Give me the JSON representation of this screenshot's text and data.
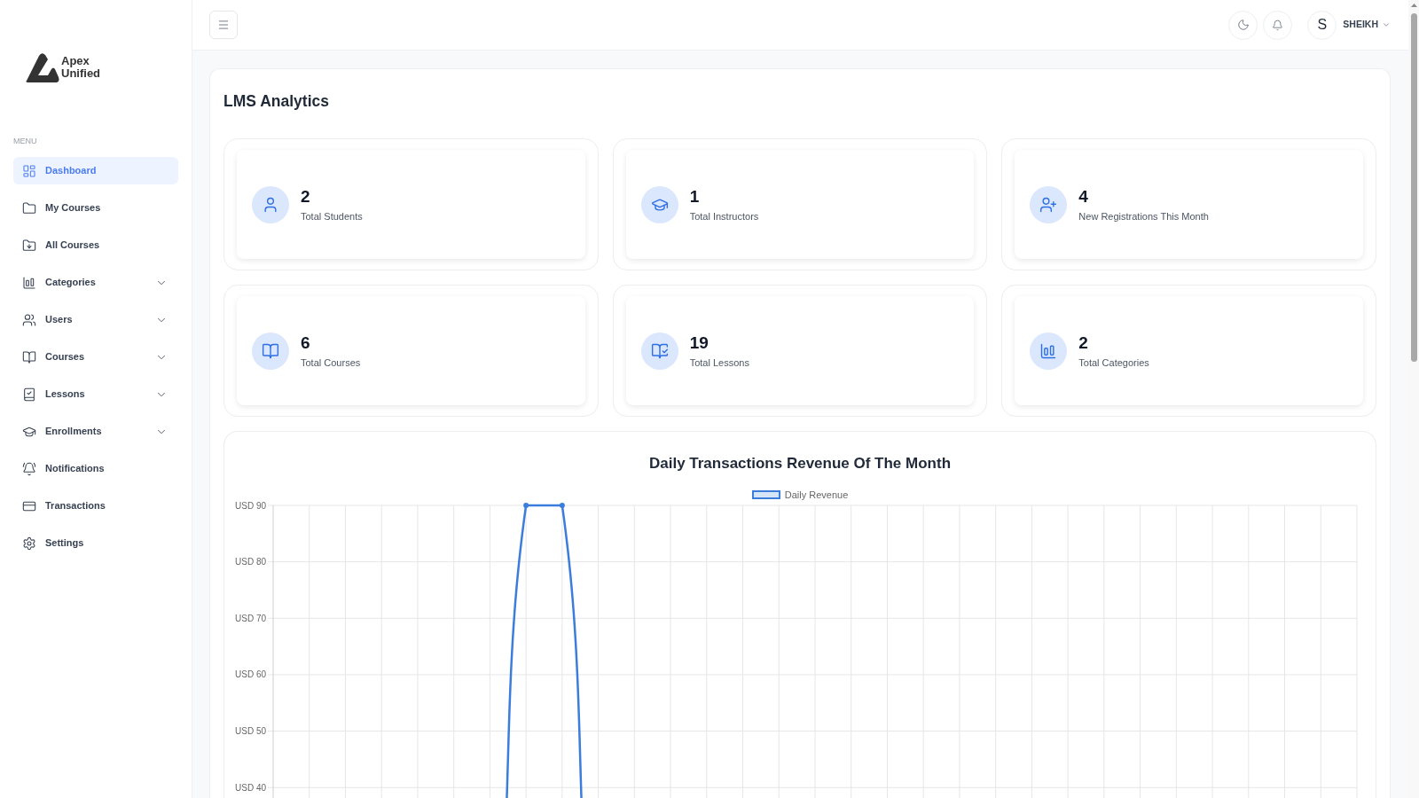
{
  "sidebar": {
    "brand": "Apex Unified",
    "section_label": "MENU",
    "items": [
      {
        "label": "Dashboard",
        "selected": true,
        "has_submenu": false
      },
      {
        "label": "My Courses",
        "selected": false,
        "has_submenu": false
      },
      {
        "label": "All Courses",
        "selected": false,
        "has_submenu": false
      },
      {
        "label": "Categories",
        "selected": false,
        "has_submenu": true
      },
      {
        "label": "Users",
        "selected": false,
        "has_submenu": true
      },
      {
        "label": "Courses",
        "selected": false,
        "has_submenu": true
      },
      {
        "label": "Lessons",
        "selected": false,
        "has_submenu": true
      },
      {
        "label": "Enrollments",
        "selected": false,
        "has_submenu": true
      },
      {
        "label": "Notifications",
        "selected": false,
        "has_submenu": false
      },
      {
        "label": "Transactions",
        "selected": false,
        "has_submenu": false
      },
      {
        "label": "Settings",
        "selected": false,
        "has_submenu": false
      }
    ]
  },
  "topbar": {
    "user": {
      "initial": "S",
      "name": "SHEIKH"
    }
  },
  "page": {
    "title": "LMS Analytics"
  },
  "stats": [
    {
      "value": "2",
      "label": "Total Students"
    },
    {
      "value": "1",
      "label": "Total Instructors"
    },
    {
      "value": "4",
      "label": "New Registrations This Month"
    },
    {
      "value": "6",
      "label": "Total Courses"
    },
    {
      "value": "19",
      "label": "Total Lessons"
    },
    {
      "value": "2",
      "label": "Total Categories"
    }
  ],
  "chart": {
    "title": "Daily Transactions Revenue Of The Month",
    "legend_label": "Daily Revenue",
    "y_axis_labels": [
      "USD 90",
      "USD 80",
      "USD 70",
      "USD 60",
      "USD 50",
      "USD 40"
    ]
  }
}
